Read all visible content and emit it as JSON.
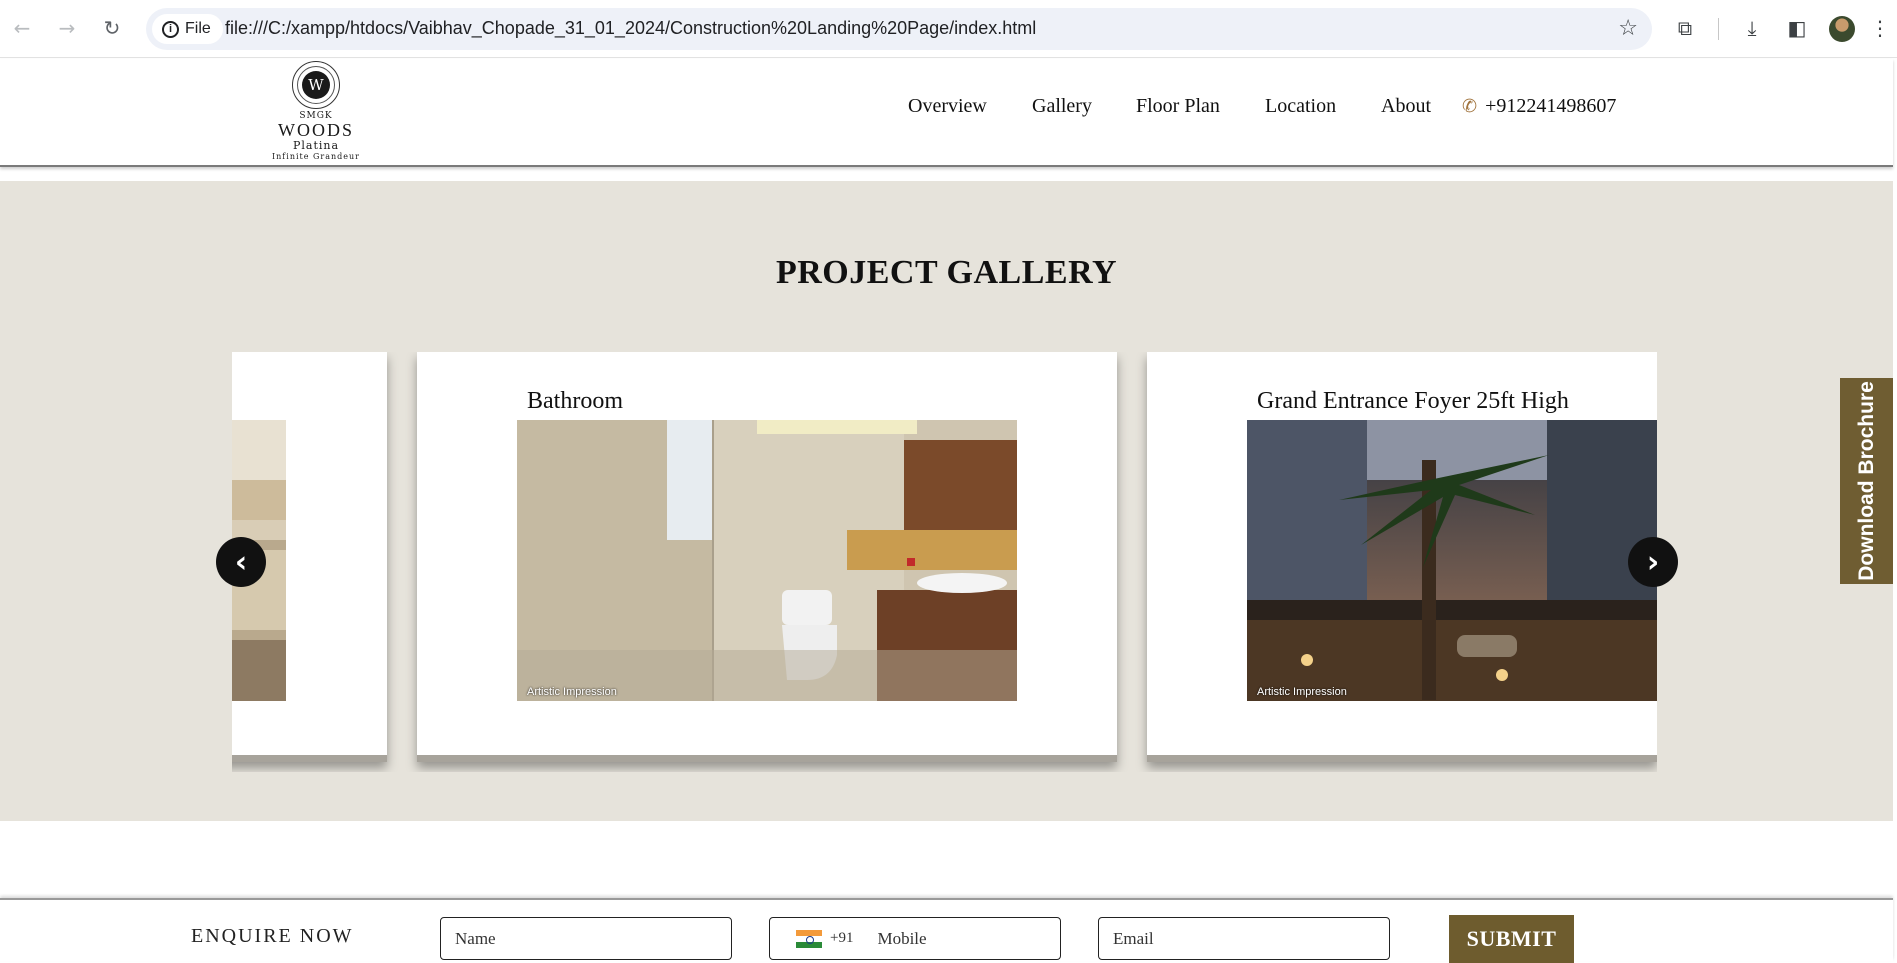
{
  "browser": {
    "site_chip": "File",
    "url": "file:///C:/xampp/htdocs/Vaibhav_Chopade_31_01_2024/Construction%20Landing%20Page/index.html"
  },
  "logo": {
    "emblem_letter": "W",
    "line1": "SMGK",
    "line2": "WOODS",
    "line3": "Platina",
    "line4": "Infinite Grandeur"
  },
  "nav": {
    "items": [
      "Overview",
      "Gallery",
      "Floor Plan",
      "Location",
      "About"
    ],
    "phone": "+912241498607"
  },
  "gallery": {
    "title": "PROJECT GALLERY",
    "cards": [
      {
        "title": "",
        "caption": ""
      },
      {
        "title": "Bathroom",
        "caption": "Artistic Impression"
      },
      {
        "title": "Grand Entrance Foyer 25ft High",
        "caption": "Artistic Impression"
      }
    ],
    "prev_glyph": "‹",
    "next_glyph": "›"
  },
  "brochure": {
    "label": "Download Brochure"
  },
  "enquire": {
    "label": "ENQUIRE NOW",
    "name_placeholder": "Name",
    "dial_code": "+91",
    "mobile_placeholder": "Mobile",
    "email_placeholder": "Email",
    "submit_label": "SUBMIT"
  },
  "colors": {
    "gallery_bg": "#e6e3db",
    "accent_brown": "#6e5c2e",
    "phone_icon": "#a0733d"
  }
}
